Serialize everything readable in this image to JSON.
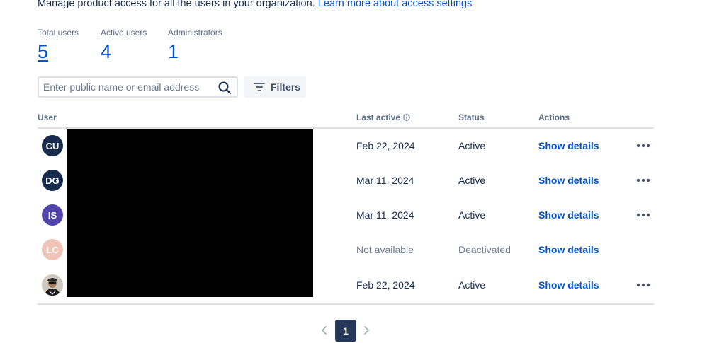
{
  "intro": {
    "text": "Manage product access for all the users in your organization. ",
    "link": "Learn more about access settings"
  },
  "stats": [
    {
      "label": "Total users",
      "value": "5"
    },
    {
      "label": "Active users",
      "value": "4"
    },
    {
      "label": "Administrators",
      "value": "1"
    }
  ],
  "search": {
    "placeholder": "Enter public name or email address",
    "value": ""
  },
  "filters": {
    "label": "Filters"
  },
  "table": {
    "headers": {
      "user": "User",
      "last_active": "Last active",
      "status": "Status",
      "actions": "Actions"
    },
    "rows": [
      {
        "initials": "CU",
        "avatar_color": "#172b4d",
        "last_active": "Feb 22, 2024",
        "status": "Active",
        "action": "Show details",
        "has_more": true
      },
      {
        "initials": "DG",
        "avatar_color": "#172b4d",
        "last_active": "Mar 11, 2024",
        "status": "Active",
        "action": "Show details",
        "has_more": true
      },
      {
        "initials": "IS",
        "avatar_color": "#5243aa",
        "last_active": "Mar 11, 2024",
        "status": "Active",
        "action": "Show details",
        "has_more": true
      },
      {
        "initials": "LC",
        "avatar_color": "#f1c4b8",
        "last_active": "Not available",
        "status": "Deactivated",
        "action": "Show details",
        "has_more": false
      },
      {
        "initials": "",
        "avatar_color": "#c9c2b8",
        "last_active": "Feb 22, 2024",
        "status": "Active",
        "action": "Show details",
        "has_more": true
      }
    ]
  },
  "pagination": {
    "current": "1"
  },
  "colors": {
    "link": "#0052cc",
    "text": "#172b4d",
    "muted": "#6b778c",
    "pager_active": "#253858"
  }
}
